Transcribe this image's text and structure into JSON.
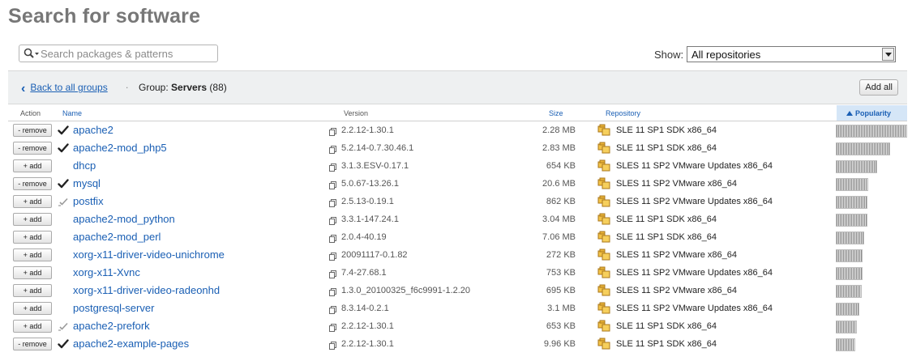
{
  "page": {
    "title": "Search for software"
  },
  "search": {
    "placeholder": "Search packages & patterns",
    "value": ""
  },
  "show": {
    "label": "Show:",
    "selected": "All repositories"
  },
  "groupbar": {
    "back_label": "Back to all groups",
    "separator": ".",
    "group_prefix": "Group:",
    "group_name": "Servers",
    "group_count": "(88)",
    "add_all_label": "Add all"
  },
  "table": {
    "headers": {
      "action": "Action",
      "name": "Name",
      "version": "Version",
      "size": "Size",
      "repository": "Repository",
      "popularity": "Popularity"
    },
    "rows": [
      {
        "action": "- remove",
        "status": "installed",
        "name": "apache2",
        "version": "2.2.12-1.30.1",
        "size": "2.28 MB",
        "repository": "SLE 11 SP1 SDK x86_64",
        "popularity": 1.0
      },
      {
        "action": "- remove",
        "status": "installed",
        "name": "apache2-mod_php5",
        "version": "5.2.14-0.7.30.46.1",
        "size": "2.83 MB",
        "repository": "SLE 11 SP1 SDK x86_64",
        "popularity": 0.76
      },
      {
        "action": "+ add",
        "status": "none",
        "name": "dhcp",
        "version": "3.1.3.ESV-0.17.1",
        "size": "654 KB",
        "repository": "SLES 11 SP2 VMware Updates x86_64",
        "popularity": 0.58
      },
      {
        "action": "- remove",
        "status": "installed",
        "name": "mysql",
        "version": "5.0.67-13.26.1",
        "size": "20.6 MB",
        "repository": "SLES 11 SP2 VMware x86_64",
        "popularity": 0.46
      },
      {
        "action": "+ add",
        "status": "auto",
        "name": "postfix",
        "version": "2.5.13-0.19.1",
        "size": "862 KB",
        "repository": "SLES 11 SP2 VMware Updates x86_64",
        "popularity": 0.44
      },
      {
        "action": "+ add",
        "status": "none",
        "name": "apache2-mod_python",
        "version": "3.3.1-147.24.1",
        "size": "3.04 MB",
        "repository": "SLE 11 SP1 SDK x86_64",
        "popularity": 0.44
      },
      {
        "action": "+ add",
        "status": "none",
        "name": "apache2-mod_perl",
        "version": "2.0.4-40.19",
        "size": "7.06 MB",
        "repository": "SLE 11 SP1 SDK x86_64",
        "popularity": 0.4
      },
      {
        "action": "+ add",
        "status": "none",
        "name": "xorg-x11-driver-video-unichrome",
        "version": "20091117-0.1.82",
        "size": "272 KB",
        "repository": "SLES 11 SP2 VMware x86_64",
        "popularity": 0.37
      },
      {
        "action": "+ add",
        "status": "none",
        "name": "xorg-x11-Xvnc",
        "version": "7.4-27.68.1",
        "size": "753 KB",
        "repository": "SLES 11 SP2 VMware Updates x86_64",
        "popularity": 0.37
      },
      {
        "action": "+ add",
        "status": "none",
        "name": "xorg-x11-driver-video-radeonhd",
        "version": "1.3.0_20100325_f6c9991-1.2.20",
        "size": "695 KB",
        "repository": "SLES 11 SP2 VMware x86_64",
        "popularity": 0.36
      },
      {
        "action": "+ add",
        "status": "none",
        "name": "postgresql-server",
        "version": "8.3.14-0.2.1",
        "size": "3.1 MB",
        "repository": "SLES 11 SP2 VMware Updates x86_64",
        "popularity": 0.33
      },
      {
        "action": "+ add",
        "status": "auto",
        "name": "apache2-prefork",
        "version": "2.2.12-1.30.1",
        "size": "653 KB",
        "repository": "SLE 11 SP1 SDK x86_64",
        "popularity": 0.3
      },
      {
        "action": "- remove",
        "status": "installed",
        "name": "apache2-example-pages",
        "version": "2.2.12-1.30.1",
        "size": "9.96 KB",
        "repository": "SLE 11 SP1 SDK x86_64",
        "popularity": 0.27
      }
    ]
  }
}
